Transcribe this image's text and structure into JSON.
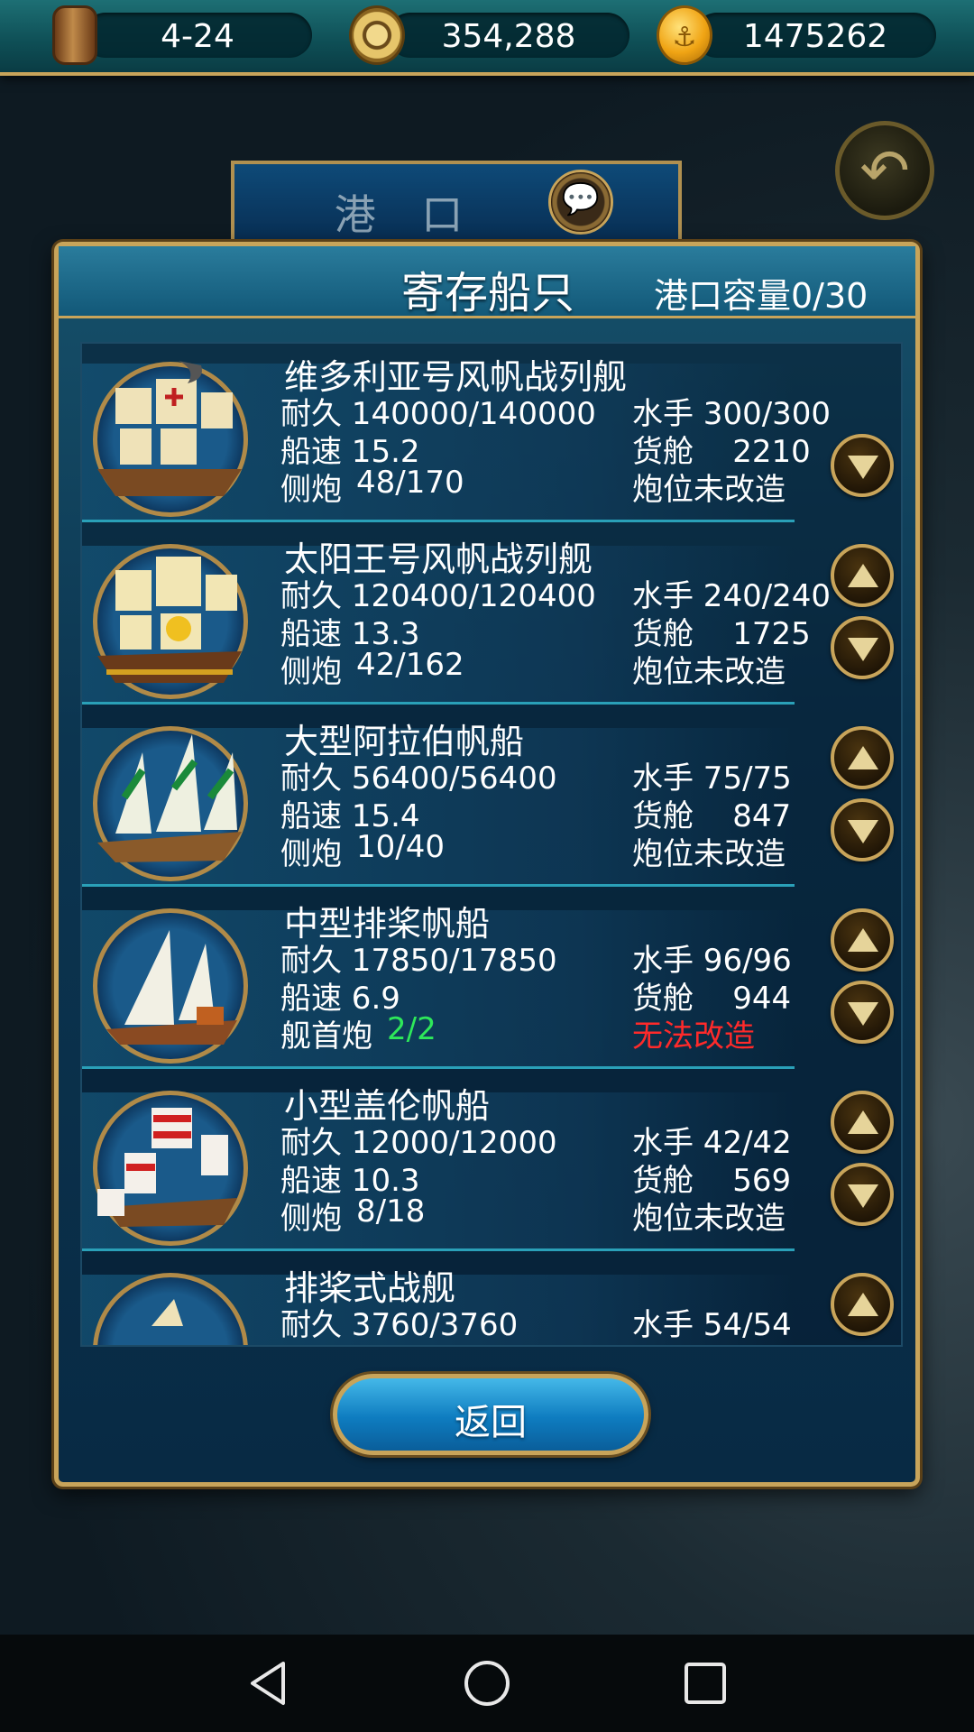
{
  "top_bar": {
    "date": "4-24",
    "ducats": "354,288",
    "gold": "1475262"
  },
  "background": {
    "port_title": "港 口",
    "chat_icon": "chat-bubble-icon",
    "back_icon": "curved-back-arrow-icon"
  },
  "dialog": {
    "title": "寄存船只",
    "capacity": "港口容量0/30",
    "ships": [
      {
        "name": "维多利亚号风帆战列舰",
        "durability": "耐久 140000/140000",
        "speed": "船速 15.2",
        "cannon_label": "侧炮",
        "cannon": "48/170",
        "crew": "水手 300/300",
        "cargo": "货舱    2210",
        "upgrade": "炮位未改造"
      },
      {
        "name": "太阳王号风帆战列舰",
        "durability": "耐久 120400/120400",
        "speed": "船速 13.3",
        "cannon_label": "侧炮",
        "cannon": "42/162",
        "crew": "水手 240/240",
        "cargo": "货舱    1725",
        "upgrade": "炮位未改造"
      },
      {
        "name": "大型阿拉伯帆船",
        "durability": "耐久 56400/56400",
        "speed": "船速 15.4",
        "cannon_label": "侧炮",
        "cannon": "10/40",
        "crew": "水手 75/75",
        "cargo": "货舱    847",
        "upgrade": "炮位未改造"
      },
      {
        "name": "中型排桨帆船",
        "durability": "耐久 17850/17850",
        "speed": "船速 6.9",
        "cannon_label": "舰首炮",
        "cannon": "2/2",
        "crew": "水手 96/96",
        "cargo": "货舱    944",
        "upgrade": "无法改造"
      },
      {
        "name": "小型盖伦帆船",
        "durability": "耐久 12000/12000",
        "speed": "船速 10.3",
        "cannon_label": "侧炮",
        "cannon": "8/18",
        "crew": "水手 42/42",
        "cargo": "货舱    569",
        "upgrade": "炮位未改造"
      },
      {
        "name": "排桨式战舰",
        "durability": "耐久 3760/3760",
        "crew": "水手 54/54"
      }
    ],
    "return_label": "返回"
  },
  "colors": {
    "frame_gold": "#c8a45a",
    "highlight_green": "#2ee85a",
    "warning_red": "#ff2a2a"
  }
}
